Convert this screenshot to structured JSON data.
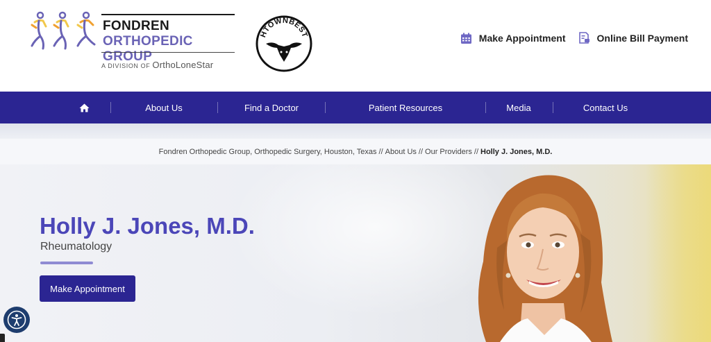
{
  "header": {
    "logo": {
      "line1": "FONDREN",
      "line2": "ORTHOPEDIC GROUP",
      "division_prefix": "A DIVISION OF",
      "division_brand": "OrthoLoneStar"
    },
    "badge_text": "HTOWNBEST",
    "links": [
      {
        "label": "Make Appointment",
        "icon": "calendar-icon"
      },
      {
        "label": "Online Bill Payment",
        "icon": "bill-payment-icon"
      }
    ]
  },
  "nav": {
    "home_icon": "home-icon",
    "items": [
      {
        "label": "About Us"
      },
      {
        "label": "Find a Doctor"
      },
      {
        "label": "Patient Resources"
      },
      {
        "label": "Media"
      },
      {
        "label": "Contact Us"
      }
    ]
  },
  "breadcrumb": {
    "separator": "//",
    "links": [
      "Fondren Orthopedic Group, Orthopedic Surgery, Houston, Texas",
      "About Us",
      "Our Providers"
    ],
    "current": "Holly J. Jones, M.D."
  },
  "hero": {
    "name": "Holly J. Jones, M.D.",
    "specialty": "Rheumatology",
    "button_label": "Make Appointment"
  },
  "accessibility": {
    "icon": "accessibility-icon"
  },
  "colors": {
    "brand_navy": "#2b2592",
    "brand_purple": "#4b46b8",
    "logo_purple": "#6a63b5",
    "accent_orange": "#f0a030",
    "accent_yellow": "#f2c84b"
  }
}
